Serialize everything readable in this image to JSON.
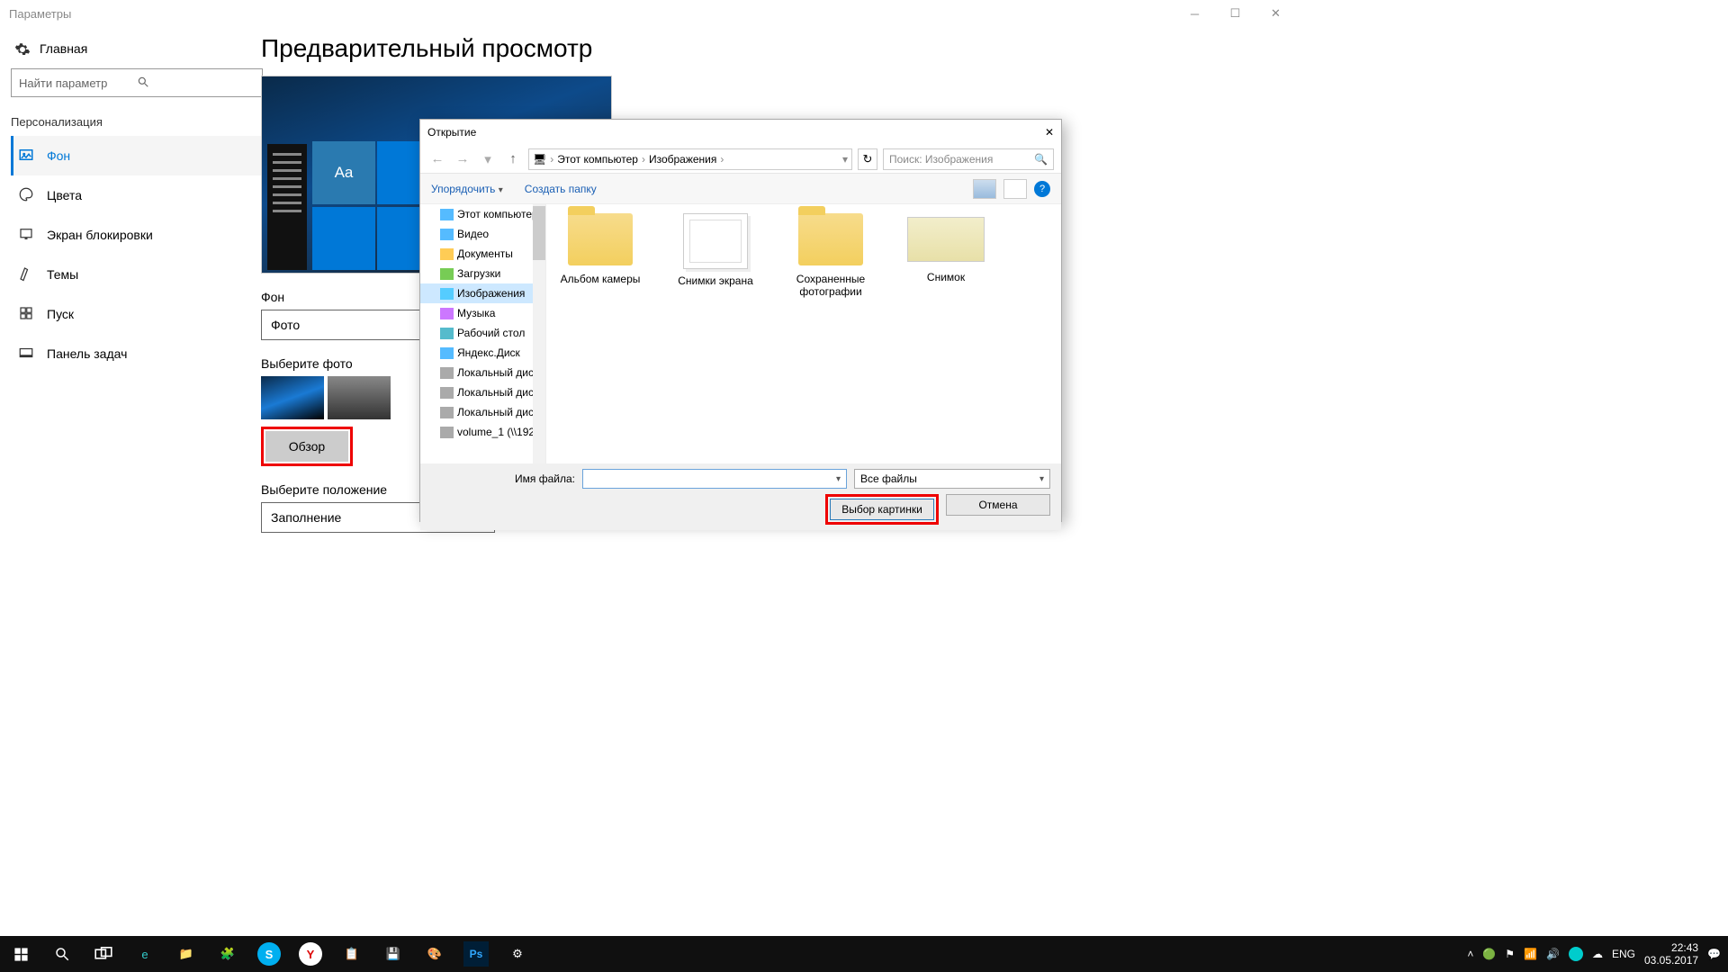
{
  "window": {
    "title": "Параметры"
  },
  "sidebar": {
    "home": "Главная",
    "search_placeholder": "Найти параметр",
    "group": "Персонализация",
    "items": [
      {
        "label": "Фон"
      },
      {
        "label": "Цвета"
      },
      {
        "label": "Экран блокировки"
      },
      {
        "label": "Темы"
      },
      {
        "label": "Пуск"
      },
      {
        "label": "Панель задач"
      }
    ]
  },
  "main": {
    "heading": "Предварительный просмотр",
    "preview_sample": "Aa",
    "bg_label": "Фон",
    "bg_value": "Фото",
    "choose_photo": "Выберите фото",
    "browse": "Обзор",
    "fit_label": "Выберите положение",
    "fit_value": "Заполнение"
  },
  "dialog": {
    "title": "Открытие",
    "breadcrumb": [
      "Этот компьютер",
      "Изображения"
    ],
    "search_placeholder": "Поиск: Изображения",
    "toolbar": {
      "organize": "Упорядочить",
      "newfolder": "Создать папку"
    },
    "tree": [
      "Этот компьютер",
      "Видео",
      "Документы",
      "Загрузки",
      "Изображения",
      "Музыка",
      "Рабочий стол",
      "Яндекс.Диск",
      "Локальный диск",
      "Локальный диск",
      "Локальный диск",
      "volume_1 (\\\\192"
    ],
    "tree_selected_index": 4,
    "files": [
      {
        "name": "Альбом камеры",
        "kind": "folder"
      },
      {
        "name": "Снимки экрана",
        "kind": "page"
      },
      {
        "name": "Сохраненные фотографии",
        "kind": "folder"
      },
      {
        "name": "Снимок",
        "kind": "map"
      }
    ],
    "filename_label": "Имя файла:",
    "filter": "Все файлы",
    "open": "Выбор картинки",
    "cancel": "Отмена"
  },
  "taskbar": {
    "lang": "ENG",
    "time": "22:43",
    "date": "03.05.2017"
  }
}
